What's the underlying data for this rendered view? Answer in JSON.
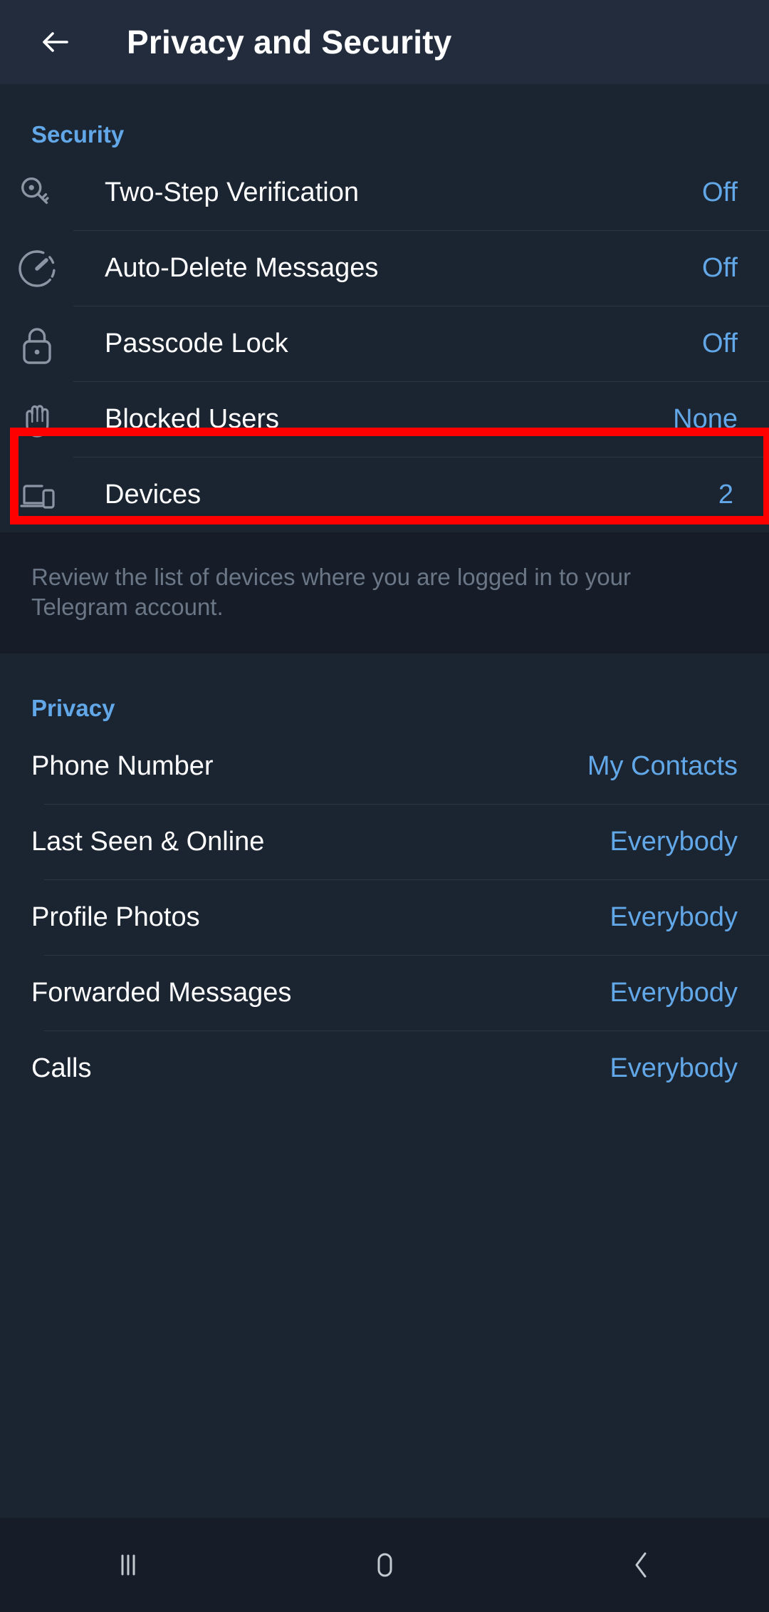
{
  "header": {
    "back_icon": "arrow-left-icon",
    "title": "Privacy and Security"
  },
  "security": {
    "section_label": "Security",
    "items": [
      {
        "icon": "key-icon",
        "label": "Two-Step Verification",
        "value": "Off"
      },
      {
        "icon": "timer-icon",
        "label": "Auto-Delete Messages",
        "value": "Off"
      },
      {
        "icon": "lock-icon",
        "label": "Passcode Lock",
        "value": "Off"
      },
      {
        "icon": "hand-icon",
        "label": "Blocked Users",
        "value": "None"
      },
      {
        "icon": "devices-icon",
        "label": "Devices",
        "value": "2"
      }
    ],
    "note": "Review the list of devices where you are logged in to your Telegram account."
  },
  "privacy": {
    "section_label": "Privacy",
    "items": [
      {
        "label": "Phone Number",
        "value": "My Contacts"
      },
      {
        "label": "Last Seen & Online",
        "value": "Everybody"
      },
      {
        "label": "Profile Photos",
        "value": "Everybody"
      },
      {
        "label": "Forwarded Messages",
        "value": "Everybody"
      },
      {
        "label": "Calls",
        "value": "Everybody"
      }
    ]
  },
  "highlight": {
    "target": "Passcode Lock",
    "color": "#ff0000"
  },
  "navbar": {
    "recents_icon": "recents-bars-icon",
    "home_icon": "home-square-icon",
    "back_icon": "back-chevron-icon"
  },
  "colors": {
    "background": "#1b2431",
    "appbar": "#222c3c",
    "note_background": "#161d28",
    "accent": "#62a8e8",
    "text_primary": "#ffffff",
    "text_muted": "#6b7786",
    "divider": "#2a3646",
    "icon": "#8b95a3"
  }
}
